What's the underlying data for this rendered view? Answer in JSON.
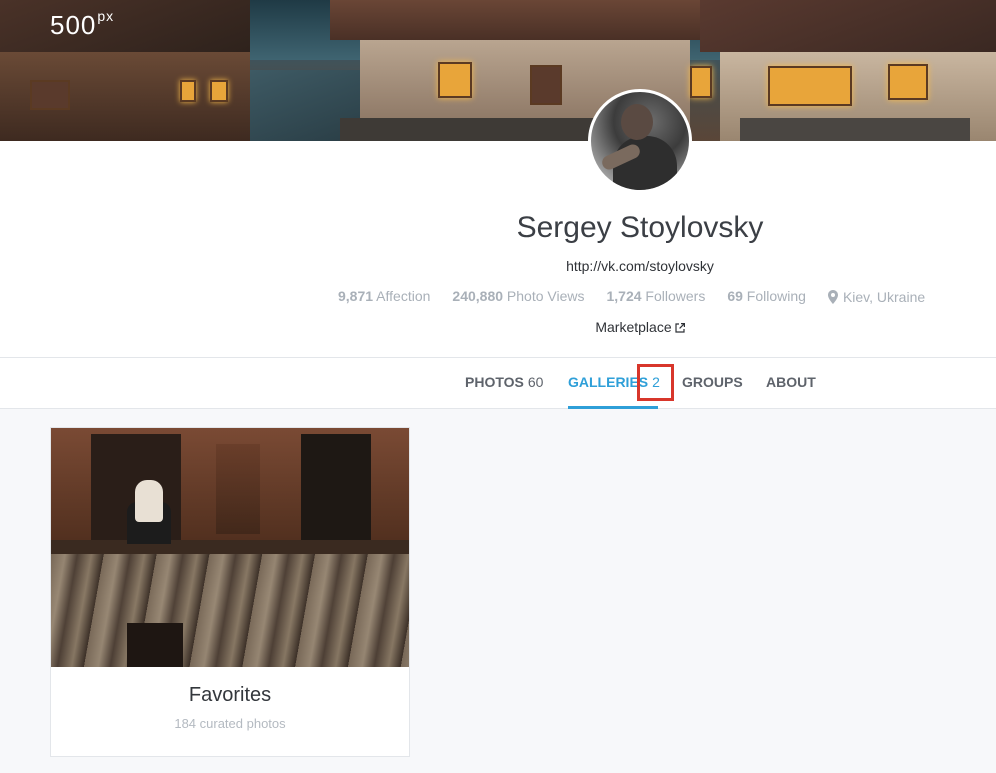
{
  "brand": {
    "logo_text": "500",
    "logo_sup": "px"
  },
  "profile": {
    "name": "Sergey Stoylovsky",
    "website": "http://vk.com/stoylovsky",
    "stats": {
      "affection_value": "9,871",
      "affection_label": "Affection",
      "views_value": "240,880",
      "views_label": "Photo Views",
      "followers_value": "1,724",
      "followers_label": "Followers",
      "following_value": "69",
      "following_label": "Following",
      "location": "Kiev, Ukraine"
    },
    "marketplace_label": "Marketplace"
  },
  "tabs": [
    {
      "label": "PHOTOS",
      "count": "60"
    },
    {
      "label": "GALLERIES",
      "count": "2"
    },
    {
      "label": "GROUPS",
      "count": ""
    },
    {
      "label": "ABOUT",
      "count": ""
    }
  ],
  "active_tab": "GALLERIES",
  "galleries": [
    {
      "title": "Favorites",
      "subtitle": "184 curated photos"
    }
  ],
  "colors": {
    "accent": "#2e9fd8",
    "highlight": "#d8362b",
    "muted": "#a9b0b8"
  },
  "icons": {
    "location": "map-pin-icon",
    "external": "external-link-icon"
  }
}
